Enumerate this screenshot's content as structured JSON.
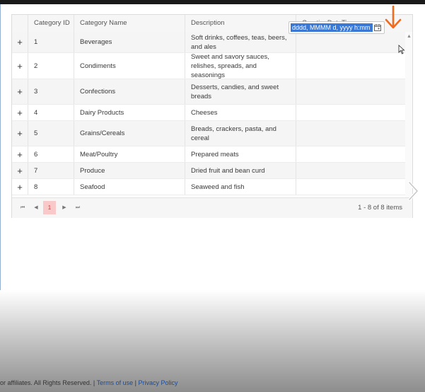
{
  "grid": {
    "columns": [
      "",
      "Category ID",
      "Category Name",
      "Description",
      "CreationDateTime"
    ],
    "rows": [
      {
        "expand": "+",
        "id": "1",
        "name": "Beverages",
        "desc": "Soft drinks, coffees, teas, beers, and ales",
        "created": ""
      },
      {
        "expand": "+",
        "id": "2",
        "name": "Condiments",
        "desc": "Sweet and savory sauces, relishes, spreads, and seasonings",
        "created": ""
      },
      {
        "expand": "+",
        "id": "3",
        "name": "Confections",
        "desc": "Desserts, candies, and sweet breads",
        "created": ""
      },
      {
        "expand": "+",
        "id": "4",
        "name": "Dairy Products",
        "desc": "Cheeses",
        "created": ""
      },
      {
        "expand": "+",
        "id": "5",
        "name": "Grains/Cereals",
        "desc": "Breads, crackers, pasta, and cereal",
        "created": ""
      },
      {
        "expand": "+",
        "id": "6",
        "name": "Meat/Poultry",
        "desc": "Prepared meats",
        "created": ""
      },
      {
        "expand": "+",
        "id": "7",
        "name": "Produce",
        "desc": "Dried fruit and bean curd",
        "created": ""
      },
      {
        "expand": "+",
        "id": "8",
        "name": "Seafood",
        "desc": "Seaweed and fish",
        "created": ""
      }
    ],
    "editor_value": "dddd, MMMM d, yyyy h:mm"
  },
  "pager": {
    "first": "⏮",
    "prev": "◀",
    "page": "1",
    "next": "▶",
    "last": "⏭",
    "info": "1 - 8 of 8 items"
  },
  "footer": {
    "prefix": "or affiliates. All Rights Reserved. | ",
    "terms": "Terms of use",
    "sep": " | ",
    "privacy": "Privacy Policy"
  },
  "colors": {
    "highlight": "#3a78d6",
    "page_active_bg": "#f9c9c9",
    "annotation_arrow": "#f26b1d",
    "link": "#1a4b9b"
  },
  "icons": [
    "calendar-icon",
    "expand-icon",
    "mouse-cursor-icon",
    "annotation-arrow-icon",
    "chevron-right-icon",
    "scroll-up-icon"
  ]
}
